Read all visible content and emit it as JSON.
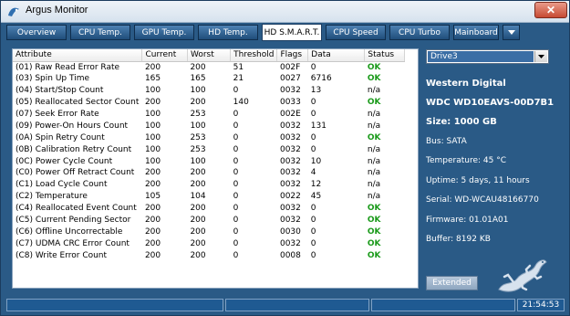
{
  "window": {
    "title": "Argus Monitor",
    "close_label": "✕"
  },
  "tabs": [
    {
      "label": "Overview"
    },
    {
      "label": "CPU Temp."
    },
    {
      "label": "GPU Temp."
    },
    {
      "label": "HD Temp."
    },
    {
      "label": "HD S.M.A.R.T."
    },
    {
      "label": "CPU Speed"
    },
    {
      "label": "CPU Turbo"
    },
    {
      "label": "Mainboard"
    }
  ],
  "active_tab": "HD S.M.A.R.T.",
  "smart_table": {
    "columns": [
      "Attribute",
      "Current",
      "Worst",
      "Threshold",
      "Flags",
      "Data",
      "Status"
    ],
    "rows": [
      [
        "(01) Raw Read Error Rate",
        "200",
        "200",
        "51",
        "002F",
        "0",
        "OK"
      ],
      [
        "(03) Spin Up Time",
        "165",
        "165",
        "21",
        "0027",
        "6716",
        "OK"
      ],
      [
        "(04) Start/Stop Count",
        "100",
        "100",
        "0",
        "0032",
        "13",
        "n/a"
      ],
      [
        "(05) Reallocated Sector Count",
        "200",
        "200",
        "140",
        "0033",
        "0",
        "OK"
      ],
      [
        "(07) Seek Error Rate",
        "100",
        "253",
        "0",
        "002E",
        "0",
        "n/a"
      ],
      [
        "(09) Power-On Hours Count",
        "100",
        "100",
        "0",
        "0032",
        "131",
        "n/a"
      ],
      [
        "(0A) Spin Retry Count",
        "100",
        "253",
        "0",
        "0032",
        "0",
        "OK"
      ],
      [
        "(0B) Calibration Retry Count",
        "100",
        "253",
        "0",
        "0032",
        "0",
        "n/a"
      ],
      [
        "(0C) Power Cycle Count",
        "100",
        "100",
        "0",
        "0032",
        "10",
        "n/a"
      ],
      [
        "(C0) Power Off Retract Count",
        "200",
        "200",
        "0",
        "0032",
        "4",
        "n/a"
      ],
      [
        "(C1) Load Cycle Count",
        "200",
        "200",
        "0",
        "0032",
        "12",
        "n/a"
      ],
      [
        "(C2) Temperature",
        "105",
        "104",
        "0",
        "0022",
        "45",
        "n/a"
      ],
      [
        "(C4) Reallocated Event Count",
        "200",
        "200",
        "0",
        "0032",
        "0",
        "OK"
      ],
      [
        "(C5) Current Pending Sector",
        "200",
        "200",
        "0",
        "0032",
        "0",
        "OK"
      ],
      [
        "(C6) Offline Uncorrectable",
        "200",
        "200",
        "0",
        "0030",
        "0",
        "OK"
      ],
      [
        "(C7) UDMA CRC Error Count",
        "200",
        "200",
        "0",
        "0032",
        "0",
        "OK"
      ],
      [
        "(C8) Write Error Count",
        "200",
        "200",
        "0",
        "0008",
        "0",
        "OK"
      ]
    ]
  },
  "drive": {
    "selected": "Drive3",
    "vendor": "Western Digital",
    "model": "WDC WD10EAVS-00D7B1",
    "size": "Size: 1000 GB",
    "bus": "Bus: SATA",
    "temperature": "Temperature: 45 °C",
    "uptime": "Uptime: 5 days, 11 hours",
    "serial": "Serial: WD-WCAU48166770",
    "firmware": "Firmware: 01.01A01",
    "buffer": "Buffer: 8192 KB"
  },
  "extended_label": "Extended",
  "status_bar": {
    "time": "21:54:53"
  },
  "colors": {
    "window_bg": "#2a5a86",
    "ok_green": "#1a9a1a",
    "tab_active_bg": "#ffffff"
  }
}
